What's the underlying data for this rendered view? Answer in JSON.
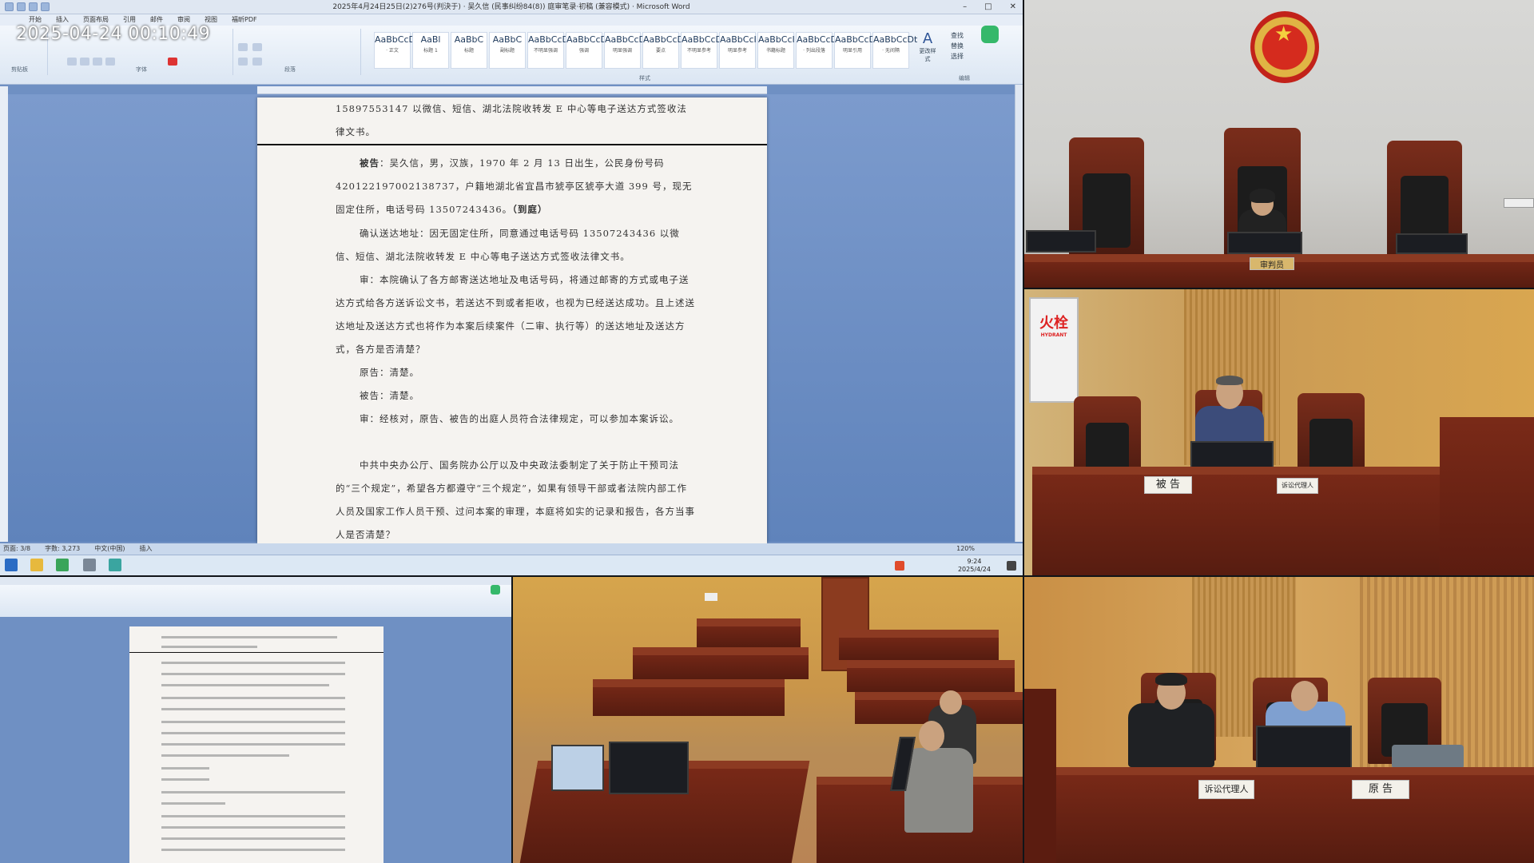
{
  "overlay": {
    "timestamp": "2025-04-24  00:10:49"
  },
  "word": {
    "window_title": "2025年4月24日25日(2)276号(判決于) · 吴久信 (民事纠纷84(8)) 庭审笔录·初稿 (兼容模式) · Microsoft Word",
    "menu": [
      "开始",
      "插入",
      "页面布局",
      "引用",
      "邮件",
      "审阅",
      "视图",
      "福昕PDF"
    ],
    "ribbon_styles": [
      {
        "preview": "AaBbCcDt",
        "name": "· 正文"
      },
      {
        "preview": "AaBl",
        "name": "标题 1"
      },
      {
        "preview": "AaBbC",
        "name": "标题"
      },
      {
        "preview": "AaBbC",
        "name": "副标题"
      },
      {
        "preview": "AaBbCcDt",
        "name": "不明显强调"
      },
      {
        "preview": "AaBbCcDt",
        "name": "强调"
      },
      {
        "preview": "AaBbCcDt",
        "name": "明显强调"
      },
      {
        "preview": "AaBbCcD",
        "name": "要点"
      },
      {
        "preview": "AaBbCcD",
        "name": "不明显参考"
      },
      {
        "preview": "AaBbCcI",
        "name": "明显参考"
      },
      {
        "preview": "AaBbCcI",
        "name": "书籍标题"
      },
      {
        "preview": "AaBbCcDt",
        "name": "· 列出段落"
      },
      {
        "preview": "AaBbCcD",
        "name": "明显引用"
      },
      {
        "preview": "AaBbCcDt",
        "name": "· 无间隔"
      }
    ],
    "ribbon_groups": [
      "剪贴板",
      "字体",
      "段落",
      "样式",
      "编辑"
    ],
    "change_styles": "更改样式",
    "find": "查找",
    "replace": "替换",
    "select": "选择",
    "document": {
      "p1": "15897553147 以微信、短信、湖北法院收转发 E 中心等电子送达方式签收法律文书。",
      "p2_label": "被告",
      "p2": "：吴久信，男，汉族，1970 年 2 月 13 日出生，公民身份号码 420122197002138737，户籍地湖北省宜昌市猇亭区猇亭大道 399 号，现无固定住所，电话号码 13507243436。",
      "p2_tail": "（到庭）",
      "p3": "确认送达地址：因无固定住所，同意通过电话号码 13507243436 以微信、短信、湖北法院收转发 E 中心等电子送达方式签收法律文书。",
      "p4": "审：本院确认了各方邮寄送达地址及电话号码，将通过邮寄的方式或电子送达方式给各方送诉讼文书，若送达不到或者拒收，也视为已经送达成功。且上述送达地址及送达方式也将作为本案后续案件（二审、执行等）的送达地址及送达方式，各方是否清楚？",
      "p5": "原告：清楚。",
      "p6": "被告：清楚。",
      "p7": "审：经核对，原告、被告的出庭人员符合法律规定，可以参加本案诉讼。",
      "p8": "中共中央办公厅、国务院办公厅以及中央政法委制定了关于防止干预司法的“三个规定”，希望各方都遵守“三个规定”，如果有领导干部或者法院内部工作人员及国家工作人员干预、过问本案的审理，本庭将如实的记录和报告，各方当事人是否清楚？"
    },
    "status": {
      "page": "页面: 3/8",
      "words": "字数: 3,273",
      "lang": "中文(中国)",
      "mode": "插入",
      "zoom": "120%"
    }
  },
  "taskbar": {
    "time": "9:24",
    "date": "2025/4/24"
  },
  "courtroom": {
    "judge_nameplate": "审判员",
    "defendant_nameplate": "被 告",
    "defendant_agent_nameplate": "诉讼代理人",
    "plaintiff_agent_nameplate": "诉讼代理人",
    "plaintiff_nameplate": "原 告",
    "hydrant_sign": "火栓",
    "hydrant_sub": "HYDRANT"
  },
  "colors": {
    "word_blue": "#6f90c3",
    "wood": "#6e2616",
    "accent_red": "#d52b1e"
  }
}
